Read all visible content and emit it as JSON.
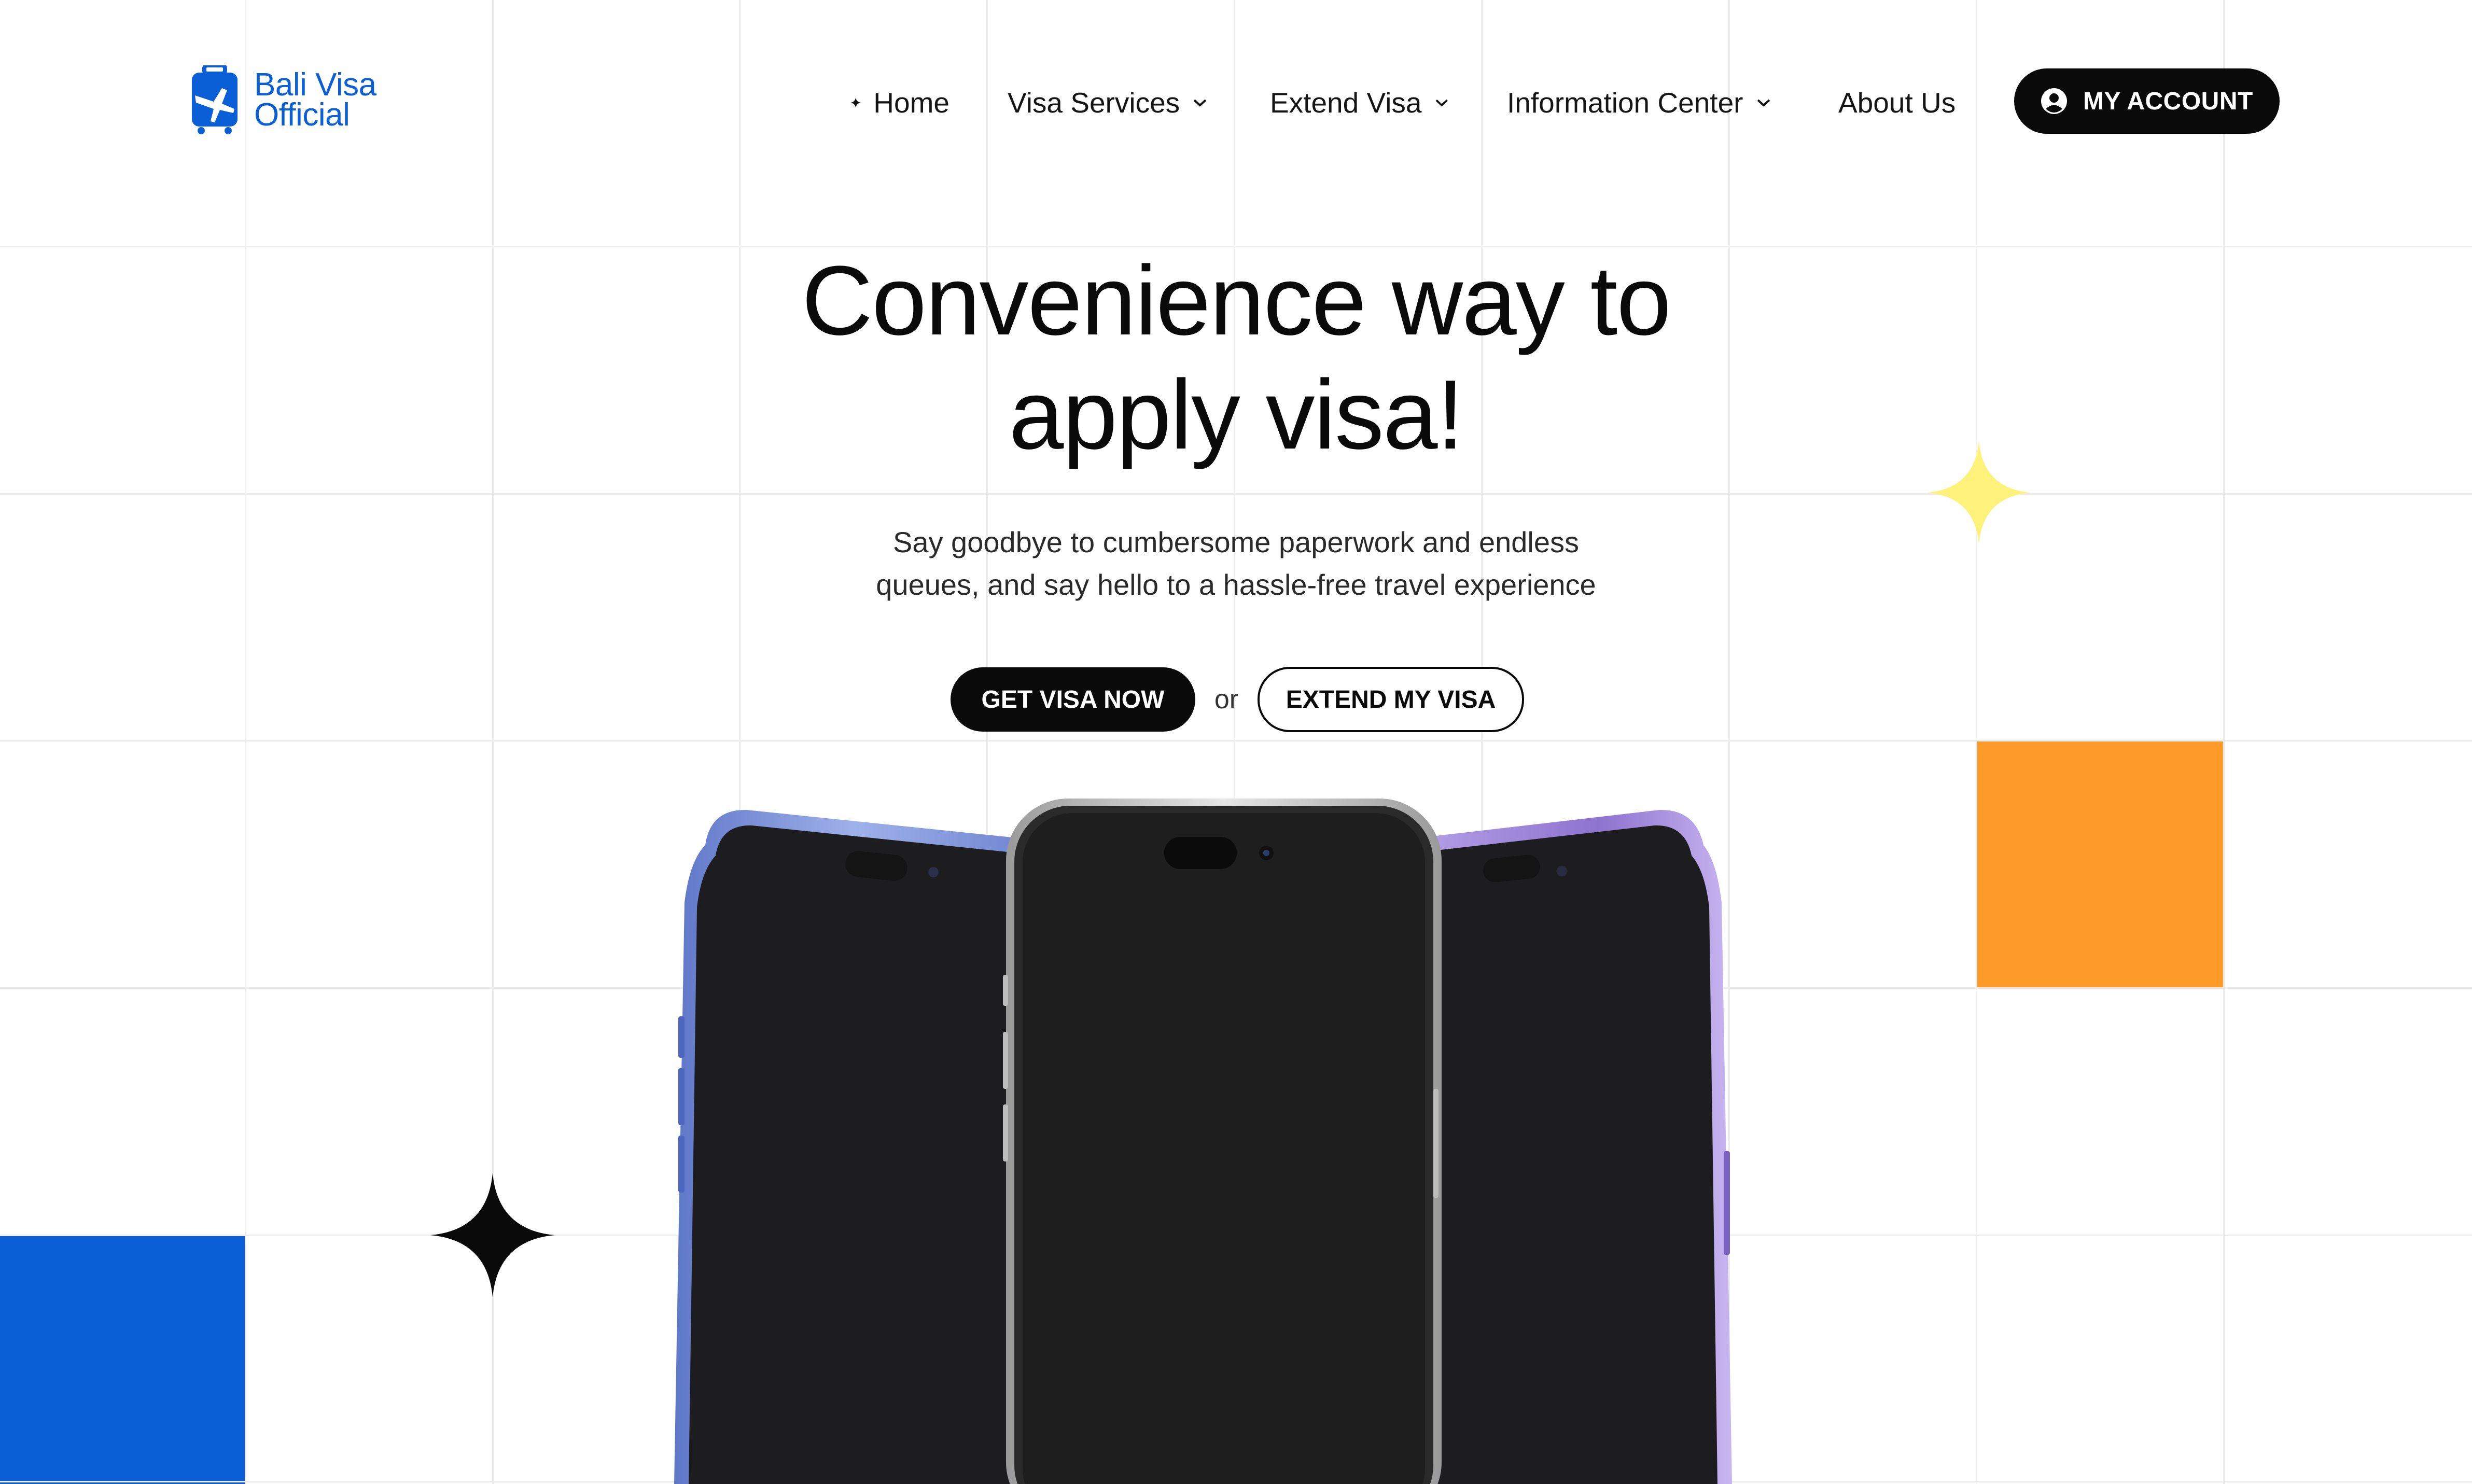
{
  "header": {
    "logo_line1": "Bali Visa",
    "logo_line2": "Official",
    "logo_icon": "suitcase-plane-icon",
    "nav": [
      {
        "label": "Home",
        "icon": "sparkle-icon"
      },
      {
        "label": "Visa Services",
        "icon": "chevron-down-icon"
      },
      {
        "label": "Extend Visa",
        "icon": "chevron-down-icon"
      },
      {
        "label": "Information Center",
        "icon": "chevron-down-icon"
      },
      {
        "label": "About Us"
      }
    ],
    "account_label": "MY ACCOUNT",
    "account_icon": "user-circle-icon"
  },
  "hero": {
    "title_line1": "Convenience way to",
    "title_line2": "apply visa!",
    "subtitle_line1": "Say goodbye to cumbersome paperwork and endless",
    "subtitle_line2": "queues, and say hello to a hassle-free travel experience",
    "primary_cta": "GET VISA NOW",
    "separator": "or",
    "secondary_cta": "EXTEND MY VISA"
  },
  "colors": {
    "brand_blue": "#0a5fd6",
    "accent_orange": "#fe9a27",
    "accent_yellow": "#fff27a",
    "dark": "#0a0a0a"
  }
}
